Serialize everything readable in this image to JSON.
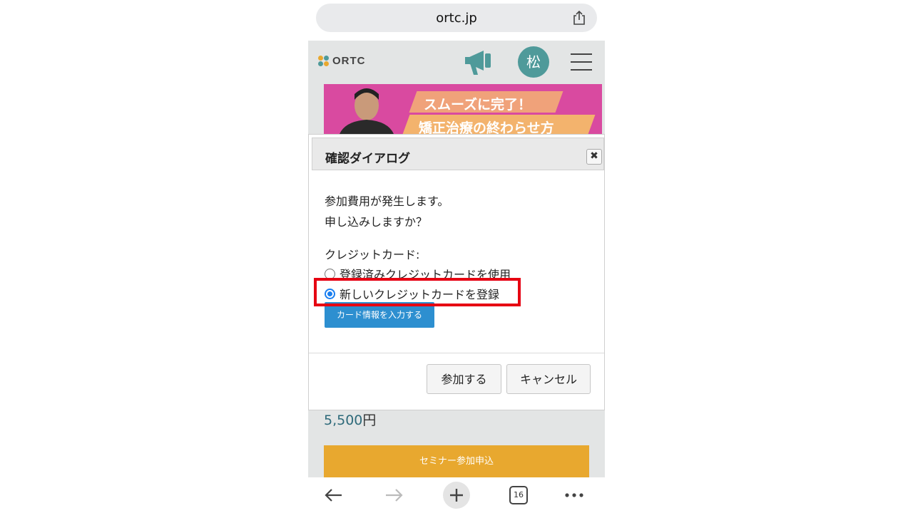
{
  "browser": {
    "url": "ortc.jp",
    "tab_count": "16"
  },
  "site": {
    "logo_text": "ORTC",
    "avatar_initial": "松",
    "banner_line1": "スムーズに完了！",
    "banner_line2": "矯正治療の終わらせ方",
    "price_value": "5,500",
    "price_unit": "円",
    "seminar_button": "セミナー参加申込"
  },
  "dialog": {
    "title": "確認ダイアログ",
    "message_line1": "参加費用が発生します。",
    "message_line2": "申し込みしますか？",
    "card_label": "クレジットカード:",
    "options": [
      {
        "label": "登録済みクレジットカードを使用",
        "checked": false
      },
      {
        "label": "新しいクレジットカードを登録",
        "checked": true
      }
    ],
    "card_info_button": "カード情報を入力する",
    "confirm_button": "参加する",
    "cancel_button": "キャンセル"
  },
  "colors": {
    "accent_blue": "#2d8fd0",
    "radio_blue": "#1a7ff0",
    "highlight_red": "#e60012",
    "seminar_orange": "#e8a82f",
    "avatar_teal": "#4f9a9a"
  }
}
